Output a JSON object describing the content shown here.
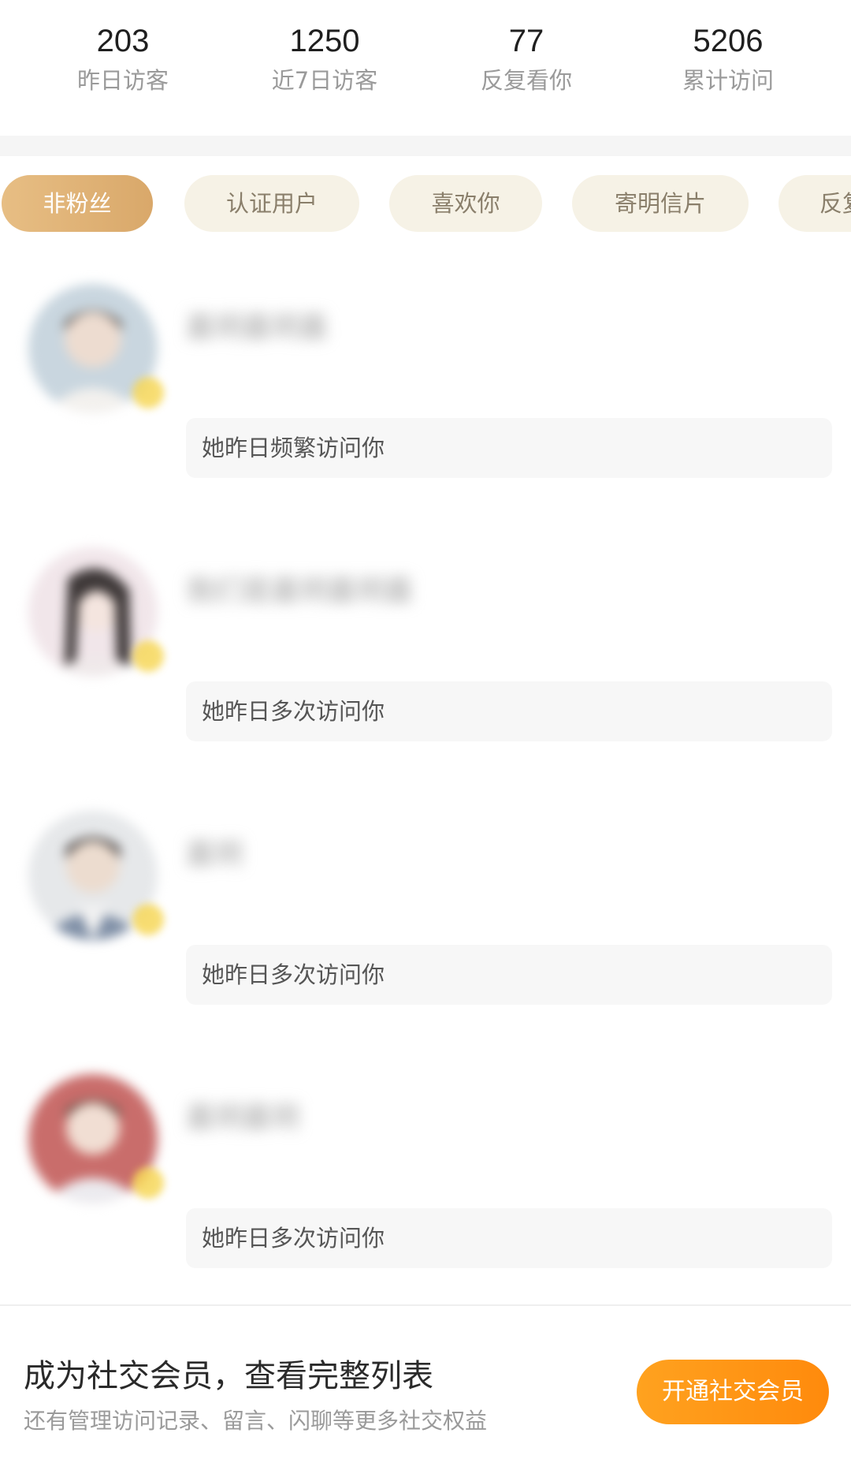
{
  "stats": [
    {
      "value": "203",
      "label": "昨日访客"
    },
    {
      "value": "1250",
      "label": "近7日访客"
    },
    {
      "value": "77",
      "label": "反复看你"
    },
    {
      "value": "5206",
      "label": "累计访问"
    }
  ],
  "filters": [
    {
      "label": "非粉丝",
      "active": true
    },
    {
      "label": "认证用户",
      "active": false
    },
    {
      "label": "喜欢你",
      "active": false
    },
    {
      "label": "寄明信片",
      "active": false
    },
    {
      "label": "反复",
      "active": false
    }
  ],
  "visitors": [
    {
      "name": "嘉玥嘉玥嘉",
      "note": "她昨日频繁访问你"
    },
    {
      "name": "我们是嘉玥嘉玥嘉",
      "note": "她昨日多次访问你"
    },
    {
      "name": "嘉玥",
      "note": "她昨日多次访问你"
    },
    {
      "name": "嘉玥嘉玥",
      "note": "她昨日多次访问你"
    }
  ],
  "banner": {
    "title": "成为社交会员，查看完整列表",
    "subtitle": "还有管理访问记录、留言、闪聊等更多社交权益",
    "cta_label": "开通社交会员"
  },
  "colors": {
    "accent_orange": "#ff9414",
    "chip_active": "#e2b478",
    "chip_inactive_bg": "#f6f2e6",
    "vip_badge": "#f6d54f"
  }
}
